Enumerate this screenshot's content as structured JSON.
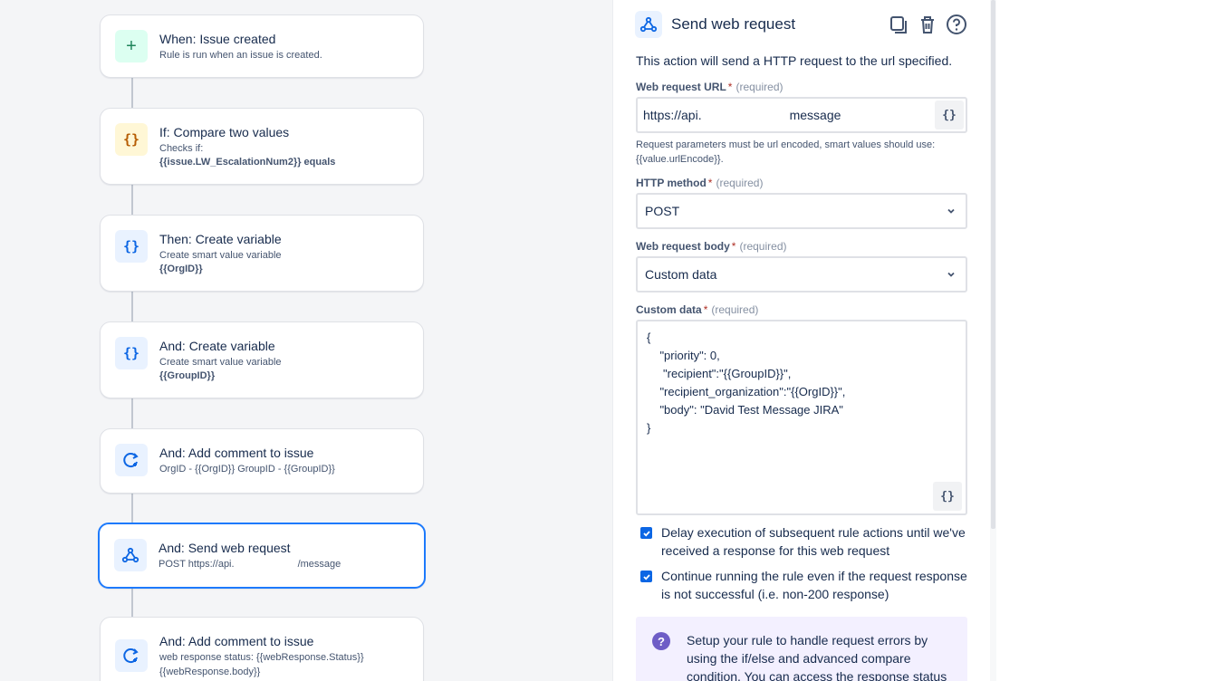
{
  "rule": {
    "cards": [
      {
        "title": "When: Issue created",
        "sub": "Rule is run when an issue is created.",
        "strong": "",
        "icon": "plus-icon"
      },
      {
        "title": "If: Compare two values",
        "sub": "Checks if:",
        "strong": "{{issue.LW_EscalationNum2}} equals",
        "icon": "braces-icon"
      },
      {
        "title": "Then: Create variable",
        "sub": "Create smart value variable",
        "strong": "{{OrgID}}",
        "icon": "braces-icon"
      },
      {
        "title": "And: Create variable",
        "sub": "Create smart value variable",
        "strong": "{{GroupID}}",
        "icon": "braces-icon"
      },
      {
        "title": "And: Add comment to issue",
        "sub": "OrgID - {{OrgID}} GroupID - {{GroupID}}",
        "strong": "",
        "icon": "comment-icon"
      },
      {
        "title": "And: Send web request",
        "sub_a": "POST https://api.",
        "sub_b": "/message",
        "icon": "webhook-icon"
      },
      {
        "title": "And: Add comment to issue",
        "sub": "web response status: {{webResponse.Status}}",
        "strong": "{{webResponse.body}}",
        "icon": "comment-icon"
      }
    ]
  },
  "panel": {
    "title": "Send web request",
    "description": "This action will send a HTTP request to the url specified.",
    "url_label": "Web request URL",
    "required_mark": "*",
    "required_text": "(required)",
    "url_value_a": "https://api.",
    "url_value_b": "message",
    "smart_value_glyph": "{}",
    "url_help": "Request parameters must be url encoded, smart values should use: {{value.urlEncode}}.",
    "method_label": "HTTP method",
    "method_value": "POST",
    "body_label": "Web request body",
    "body_value": "Custom data",
    "custom_label": "Custom data",
    "custom_lines": [
      "{",
      "    \"priority\": 0,",
      "     \"recipient\":\"{{GroupID}}\",",
      "    \"recipient_organization\":\"{{OrgID}}\",",
      "    \"body\": \"David Test Message JIRA\"",
      "}"
    ],
    "check1": "Delay execution of subsequent rule actions until we've received a response for this web request",
    "check2": "Continue running the rule even if the request response is not successful (i.e. non-200 response)",
    "info_text": "Setup your rule to handle request errors by using the if/else and advanced compare condition. You can access the response status"
  },
  "colors": {
    "accent": "#0c66e4",
    "selected_border": "#1d7afc",
    "info_bg": "#f3f0ff"
  }
}
